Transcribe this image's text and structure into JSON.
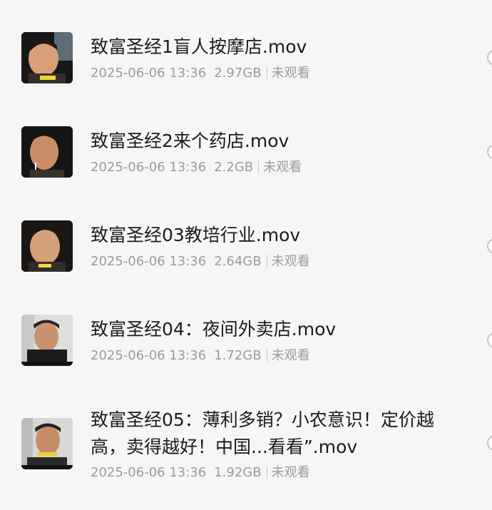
{
  "files": [
    {
      "name": "致富圣经1盲人按摩店.mov",
      "date": "2025-06-06 13:36",
      "size": "2.97GB",
      "status": "未观看",
      "thumbnail": "person-portrait-thumbnail"
    },
    {
      "name": "致富圣经2来个药店.mov",
      "date": "2025-06-06 13:36",
      "size": "2.2GB",
      "status": "未观看",
      "thumbnail": "person-portrait-thumbnail"
    },
    {
      "name": "致富圣经03教培行业.mov",
      "date": "2025-06-06 13:36",
      "size": "2.64GB",
      "status": "未观看",
      "thumbnail": "person-portrait-thumbnail"
    },
    {
      "name": "致富圣经04：夜间外卖店.mov",
      "date": "2025-06-06 13:36",
      "size": "1.72GB",
      "status": "未观看",
      "thumbnail": "person-portrait-thumbnail"
    },
    {
      "name": "致富圣经05：薄利多销？小农意识！定价越高，卖得越好！中国...看看”.mov",
      "date": "2025-06-06 13:36",
      "size": "1.92GB",
      "status": "未观看",
      "thumbnail": "person-portrait-thumbnail"
    }
  ],
  "colors": {
    "background": "#f6f6f7",
    "title": "#1b1b1f",
    "meta": "#9a9aa0",
    "divider": "#c6c6cb"
  }
}
